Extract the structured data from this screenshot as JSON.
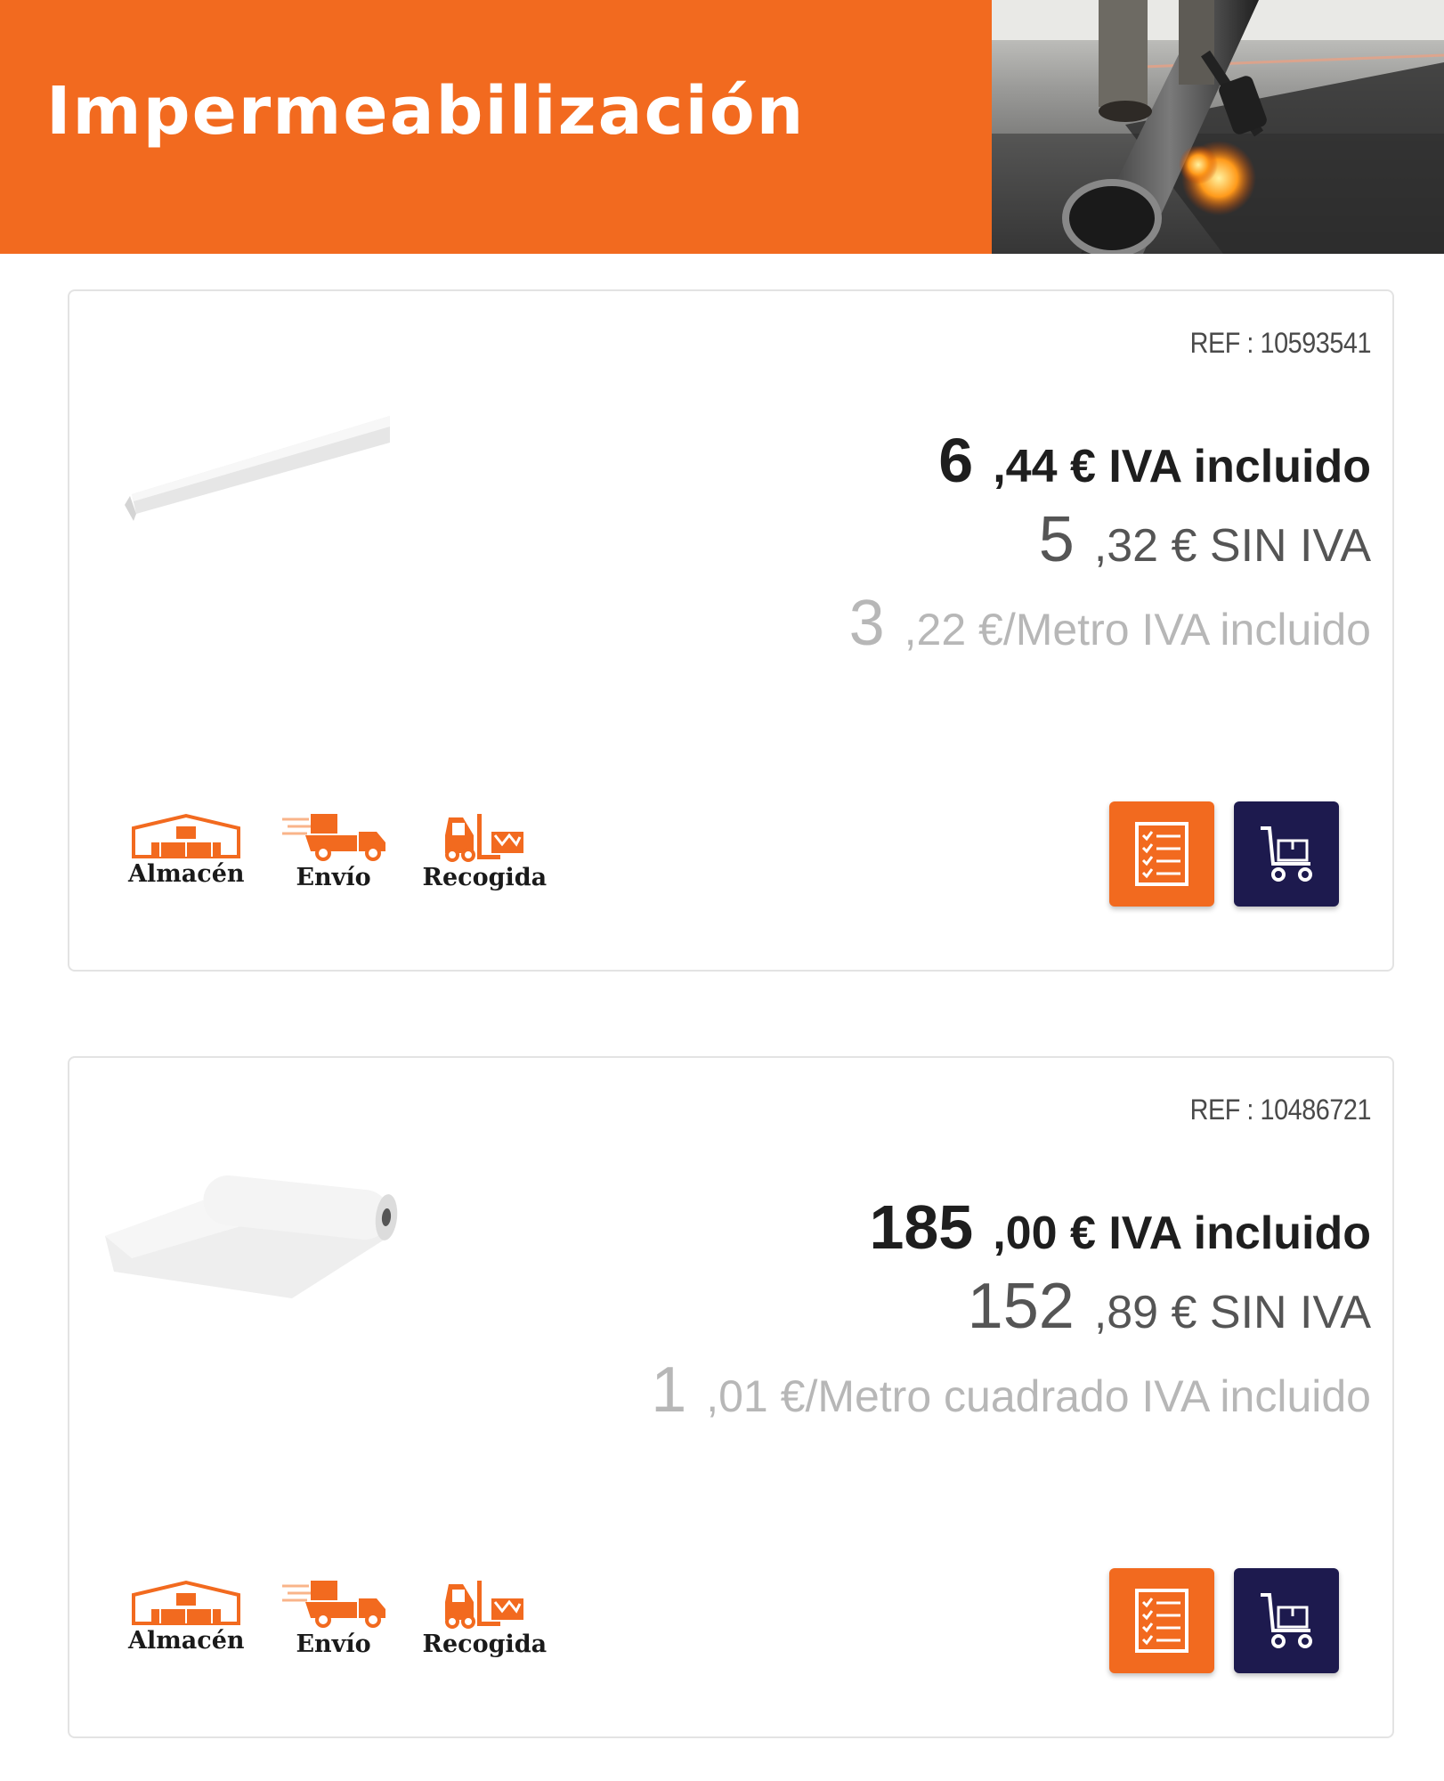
{
  "header": {
    "title": "Impermeabilización",
    "image_alt": "worker-torching-roofing-membrane-photo"
  },
  "colors": {
    "brand_orange": "#f26a1f",
    "cart_navy": "#1d1a4e",
    "price_dark": "#1e1e1e",
    "price_mid": "#555555",
    "price_light": "#b7b7b7"
  },
  "products": [
    {
      "ref": "REF : 10593541",
      "image": "white-corner-profile",
      "price_vat": {
        "int": "6",
        "rest": ",44 € IVA incluido"
      },
      "price_novat": {
        "int": "5",
        "rest": ",32 € SIN IVA"
      },
      "price_unit": {
        "int": "3",
        "rest": ",22 €/Metro IVA incluido"
      },
      "services": [
        {
          "label": "Almacén",
          "icon": "warehouse-icon"
        },
        {
          "label": "Envío",
          "icon": "delivery-truck-icon"
        },
        {
          "label": "Recogida",
          "icon": "forklift-icon"
        }
      ],
      "buttons": {
        "list": "checklist-icon",
        "cart": "cart-icon"
      }
    },
    {
      "ref": "REF : 10486721",
      "image": "white-membrane-roll",
      "price_vat": {
        "int": "185",
        "rest": ",00 € IVA incluido"
      },
      "price_novat": {
        "int": "152",
        "rest": ",89 € SIN IVA"
      },
      "price_unit": {
        "int": "1",
        "rest": ",01 €/Metro cuadrado IVA incluido"
      },
      "services": [
        {
          "label": "Almacén",
          "icon": "warehouse-icon"
        },
        {
          "label": "Envío",
          "icon": "delivery-truck-icon"
        },
        {
          "label": "Recogida",
          "icon": "forklift-icon"
        }
      ],
      "buttons": {
        "list": "checklist-icon",
        "cart": "cart-icon"
      }
    }
  ]
}
